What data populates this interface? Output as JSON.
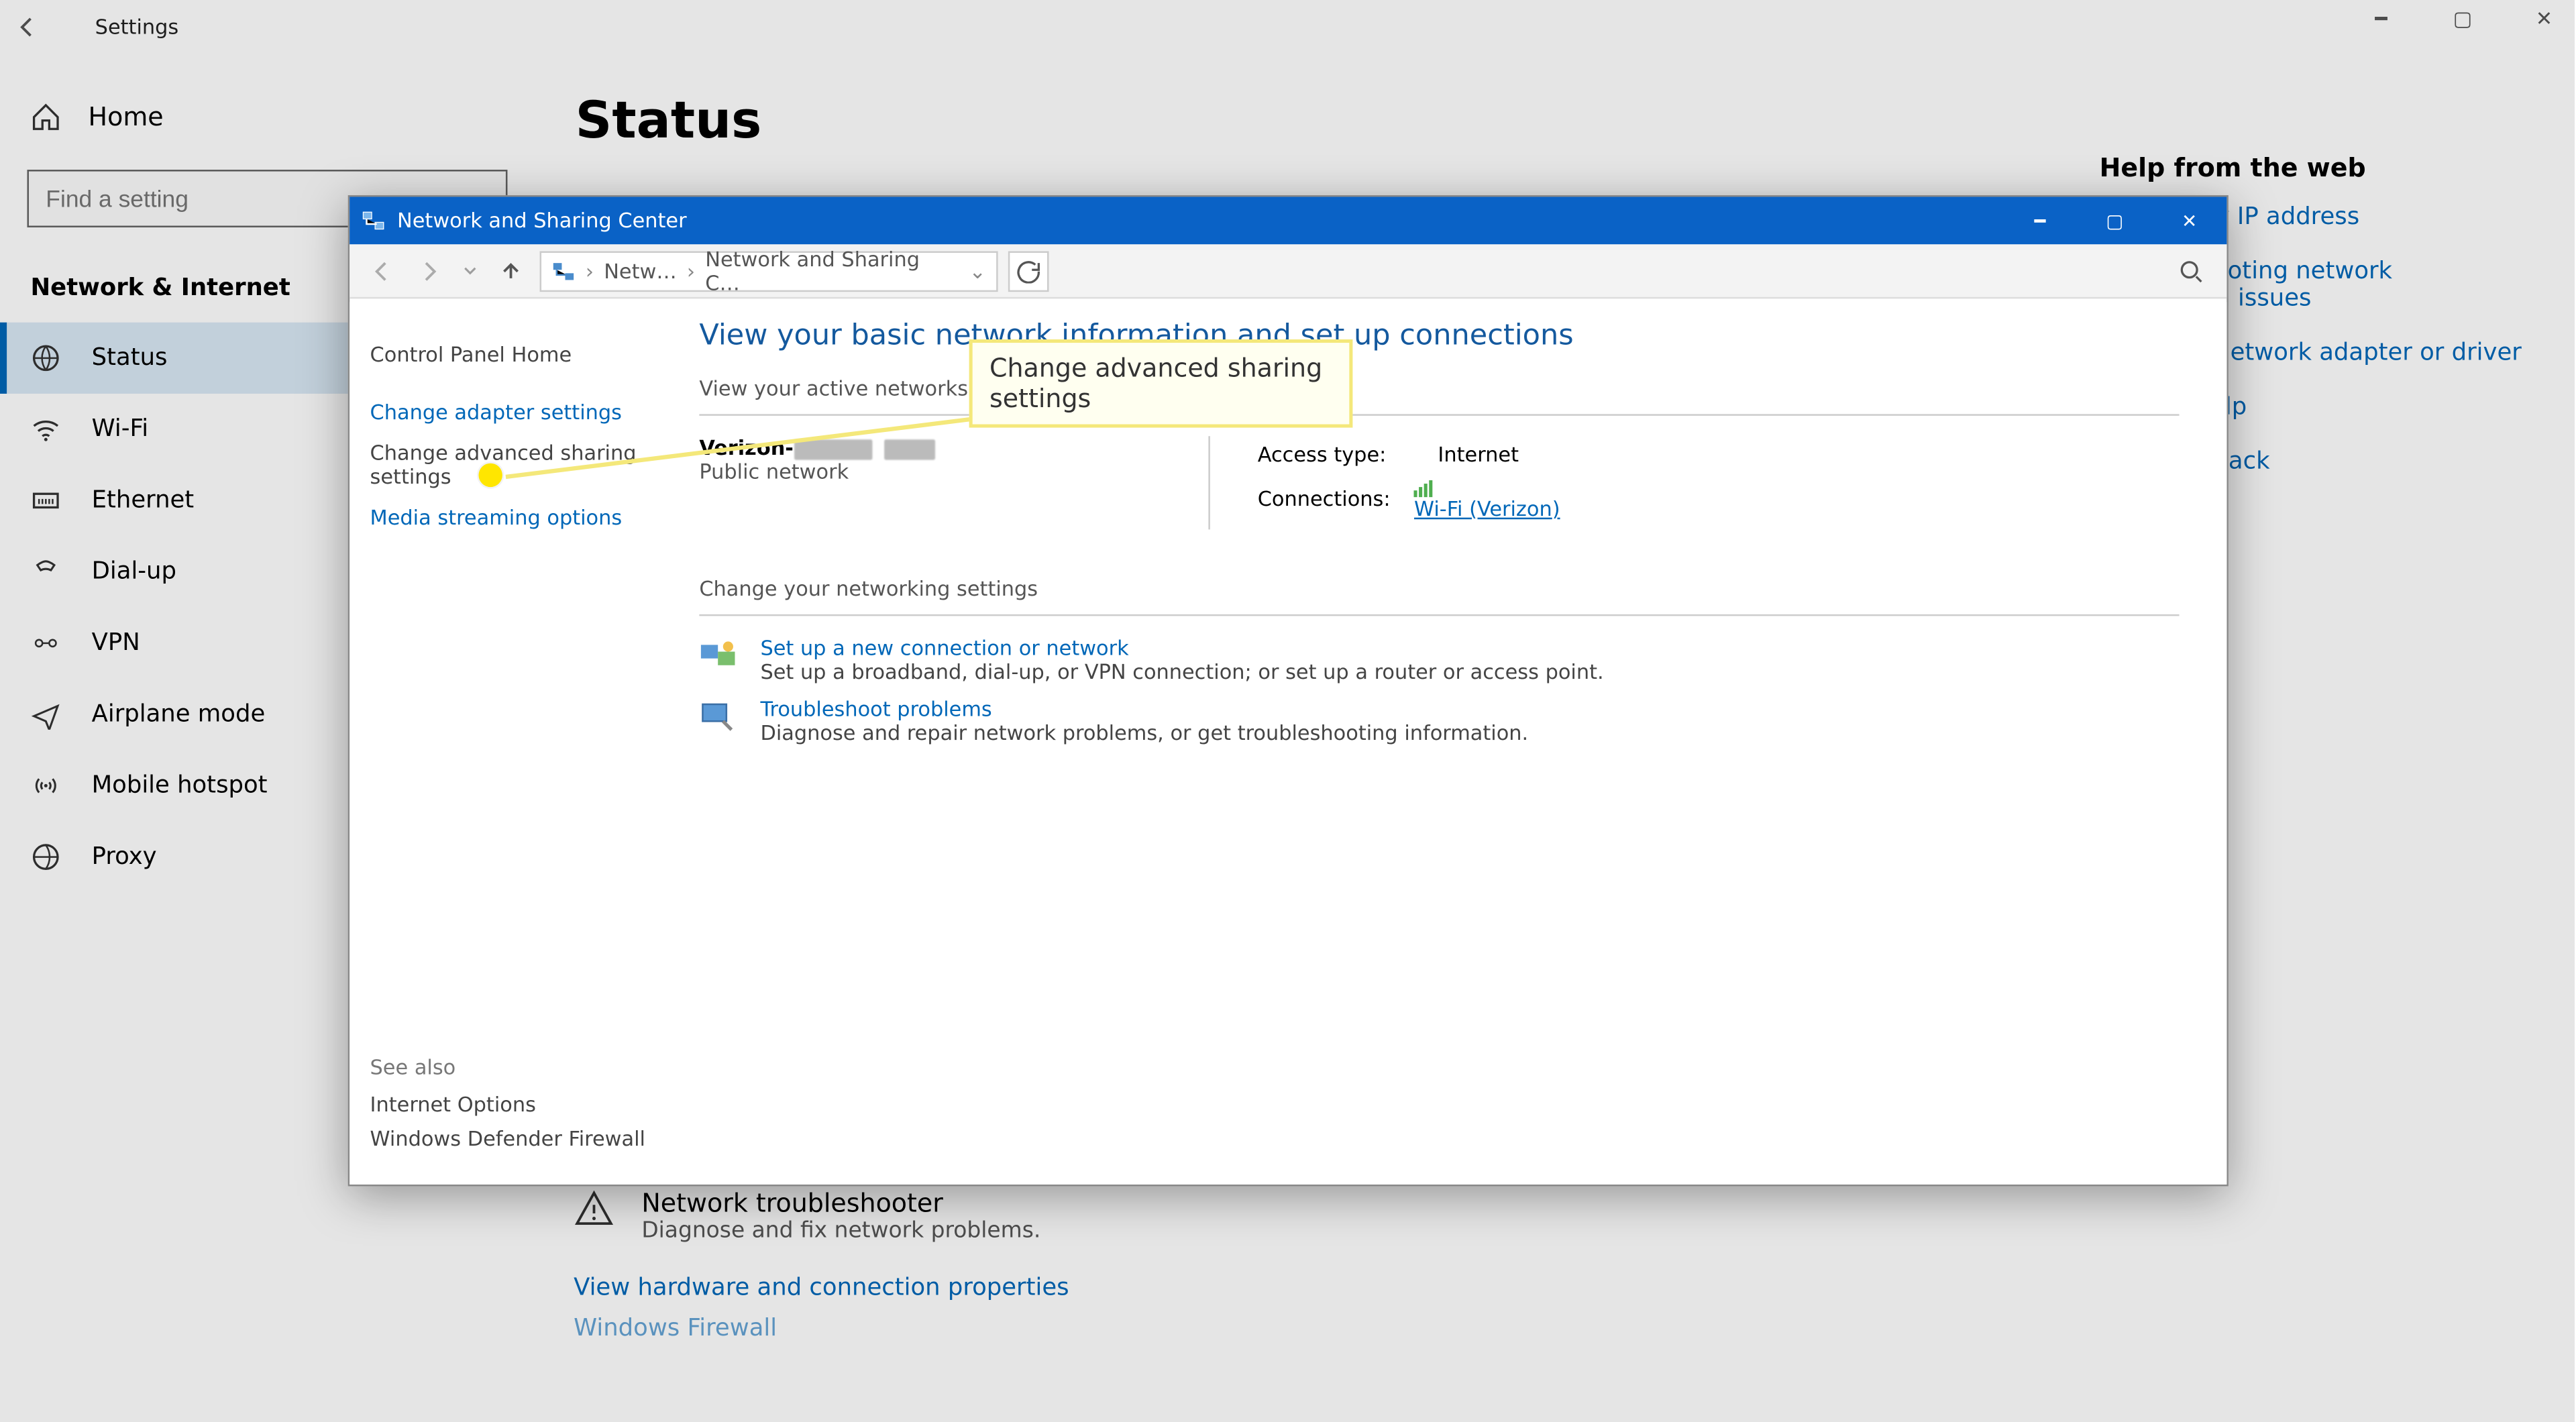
{
  "bg": {
    "titlebar": {
      "title": "Settings"
    },
    "home_label": "Home",
    "search_placeholder": "Find a setting",
    "section_heading": "Network & Internet",
    "nav": [
      {
        "icon": "status-icon",
        "label": "Status",
        "active": true
      },
      {
        "icon": "wifi-icon",
        "label": "Wi-Fi"
      },
      {
        "icon": "ethernet-icon",
        "label": "Ethernet"
      },
      {
        "icon": "dialup-icon",
        "label": "Dial-up"
      },
      {
        "icon": "vpn-icon",
        "label": "VPN"
      },
      {
        "icon": "airplane-icon",
        "label": "Airplane mode"
      },
      {
        "icon": "hotspot-icon",
        "label": "Mobile hotspot"
      },
      {
        "icon": "proxy-icon",
        "label": "Proxy"
      }
    ],
    "page_title": "Status",
    "help": {
      "heading": "Help from the web",
      "links": [
        "Finding my IP address",
        "Troubleshooting network connection issues",
        "Updating network adapter or driver",
        "Getting help",
        "Give feedback"
      ]
    },
    "troubleshooter": {
      "title": "Network troubleshooter",
      "sub": "Diagnose and fix network problems.",
      "link1": "View hardware and connection properties",
      "link2": "Windows Firewall"
    }
  },
  "cp": {
    "title": "Network and Sharing Center",
    "crumbs": {
      "a": "Netw…",
      "b": "Network and Sharing C…"
    },
    "left": {
      "home": "Control Panel Home",
      "links": [
        "Change adapter settings",
        "Change advanced sharing settings",
        "Media streaming options"
      ],
      "see_also_hdr": "See also",
      "see_also": [
        "Internet Options",
        "Windows Defender Firewall"
      ]
    },
    "main": {
      "heading": "View your basic network information and set up connections",
      "active_label": "View your active networks",
      "net_name_prefix": "Verizon-",
      "net_type": "Public network",
      "access_label": "Access type:",
      "access_value": "Internet",
      "conn_label": "Connections:",
      "conn_link_prefix": "Wi-Fi (Verizon",
      "conn_link_suffix": ")",
      "change_label": "Change your networking settings",
      "setup_link": "Set up a new connection or network",
      "setup_desc": "Set up a broadband, dial-up, or VPN connection; or set up a router or access point.",
      "troubleshoot_link": "Troubleshoot problems",
      "troubleshoot_desc": "Diagnose and repair network problems, or get troubleshooting information."
    }
  },
  "callout": {
    "text": "Change advanced sharing settings"
  }
}
